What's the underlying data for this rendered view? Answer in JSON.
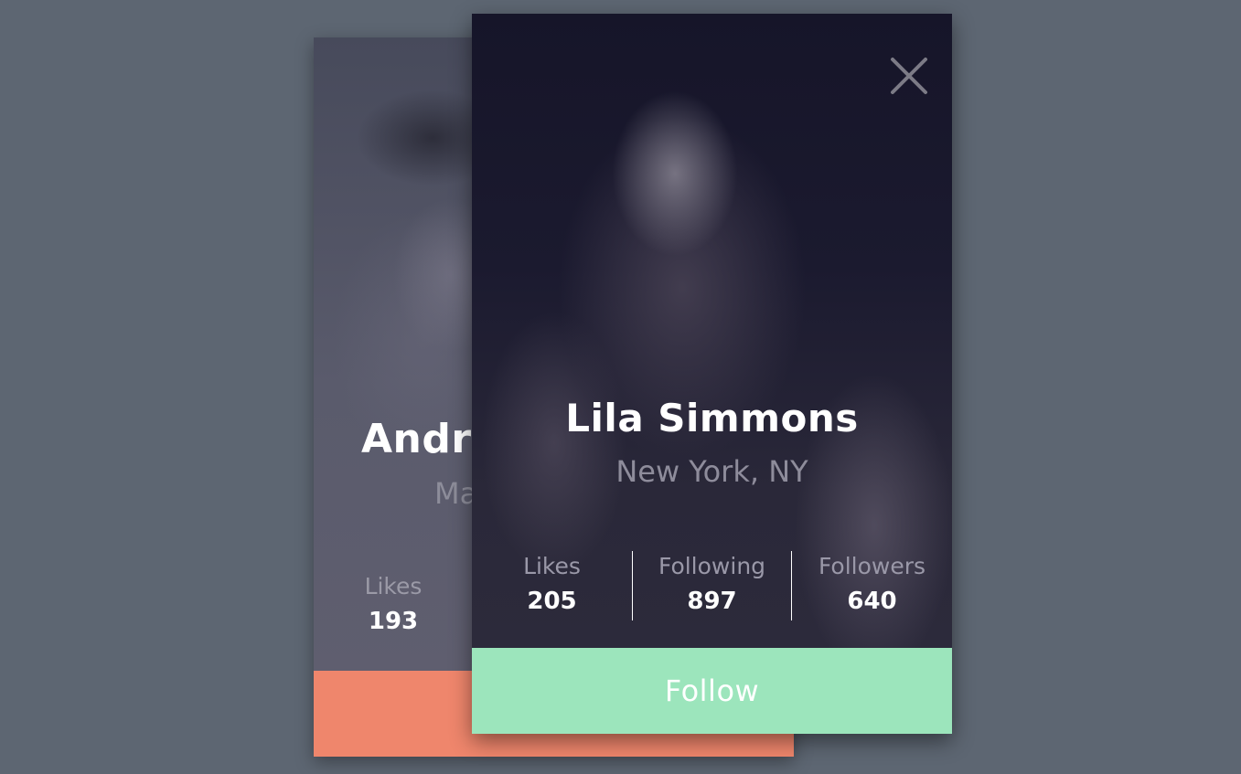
{
  "back_card": {
    "name": "Andr",
    "location": "Ma",
    "likes_label": "Likes",
    "likes_value": "193",
    "button_color": "#ef866c"
  },
  "front_card": {
    "close_icon": "close-icon",
    "name": "Lila Simmons",
    "location": "New York, NY",
    "stats": [
      {
        "label": "Likes",
        "value": "205"
      },
      {
        "label": "Following",
        "value": "897"
      },
      {
        "label": "Followers",
        "value": "640"
      }
    ],
    "follow_label": "Follow",
    "button_color": "#9ce5bc"
  },
  "colors": {
    "background": "#5d6672",
    "front_card_bg": "#0e0d22",
    "back_card_bg": "#4b4d5e"
  }
}
